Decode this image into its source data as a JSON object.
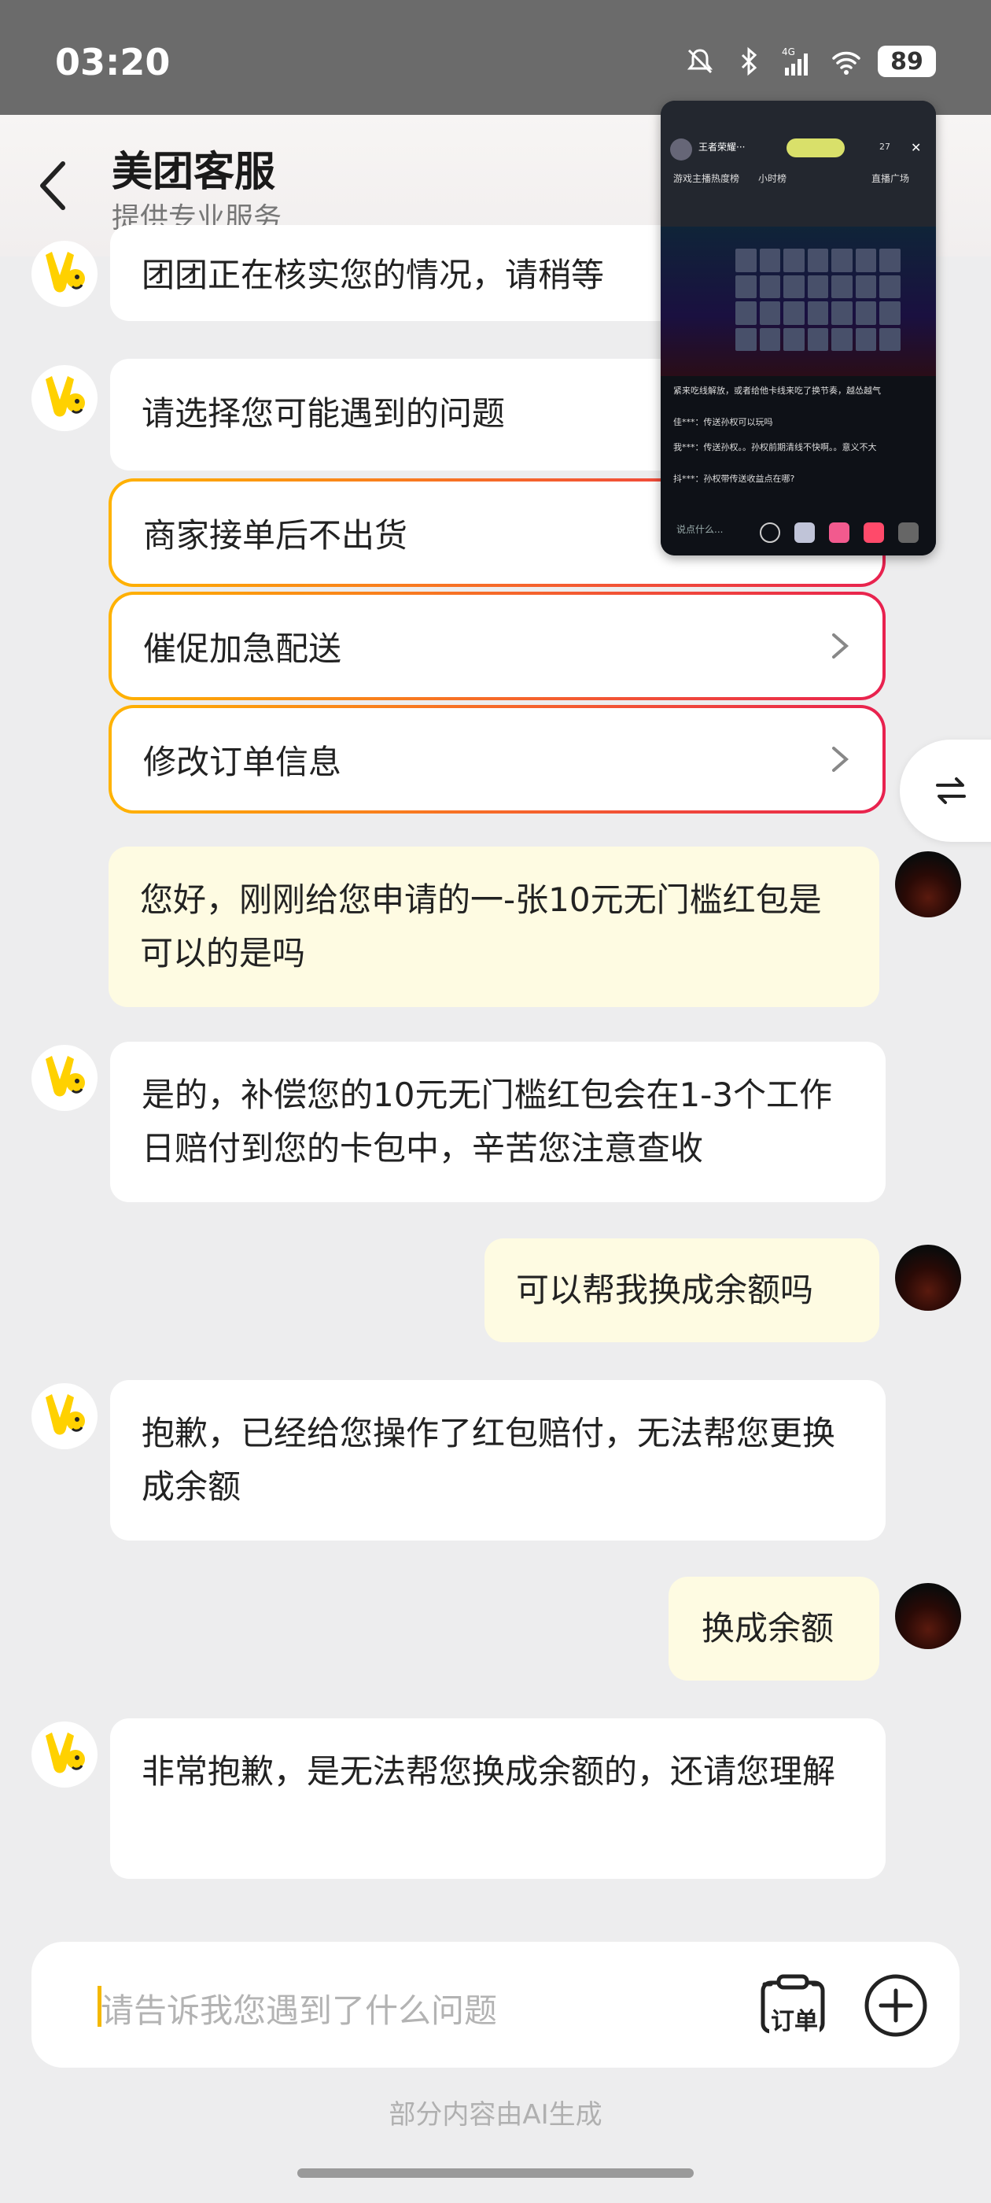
{
  "status_bar": {
    "time": "03:20",
    "battery": "89",
    "icons": [
      "mute-icon",
      "bluetooth-icon",
      "signal-4g-icon",
      "wifi-icon"
    ]
  },
  "header": {
    "title": "美团客服",
    "subtitle": "提供专业服务",
    "back_icon": "chevron-left-icon"
  },
  "messages": [
    {
      "role": "bot",
      "text": "团团正在核实您的情况，请稍等"
    },
    {
      "role": "bot",
      "text": "请选择您可能遇到的问题"
    },
    {
      "role": "option",
      "text": "商家接单后不出货"
    },
    {
      "role": "option",
      "text": "催促加急配送"
    },
    {
      "role": "option",
      "text": "修改订单信息"
    },
    {
      "role": "user",
      "text": "您好，刚刚给您申请的一-张10元无门槛红包是可以的是吗"
    },
    {
      "role": "bot",
      "text": "是的，补偿您的10元无门槛红包会在1-3个工作日赔付到您的卡包中，辛苦您注意查收"
    },
    {
      "role": "user",
      "text": "可以帮我换成余额吗"
    },
    {
      "role": "bot",
      "text": "抱歉，已经给您操作了红包赔付，无法帮您更换成余额"
    },
    {
      "role": "user",
      "text": "换成余额"
    },
    {
      "role": "bot",
      "text": "非常抱歉，是无法帮您换成余额的，还请您理解"
    }
  ],
  "input": {
    "placeholder": "请告诉我您遇到了什么问题",
    "order_label": "订单"
  },
  "footer_note": "部分内容由AI生成",
  "pip_window": {
    "streamer_name": "王者荣耀···",
    "viewer_count": "27",
    "tags": [
      "游戏主播热度榜",
      "小时榜",
      "直播广场"
    ],
    "chat_lines": [
      "紧来吃线解放，或者给他卡线来吃了换节奏，越怂越气",
      "佳***：传送孙权可以玩吗",
      "我***：传送孙权。。孙权前期清线不快啊。。意义不大",
      "抖***：孙权带传送收益点在哪?"
    ],
    "input_placeholder": "说点什么..."
  },
  "colors": {
    "brand_yellow": "#ffd100",
    "user_bubble": "#fefbe2",
    "option_gradient_start": "#ffb300",
    "option_gradient_end": "#e8214f"
  }
}
